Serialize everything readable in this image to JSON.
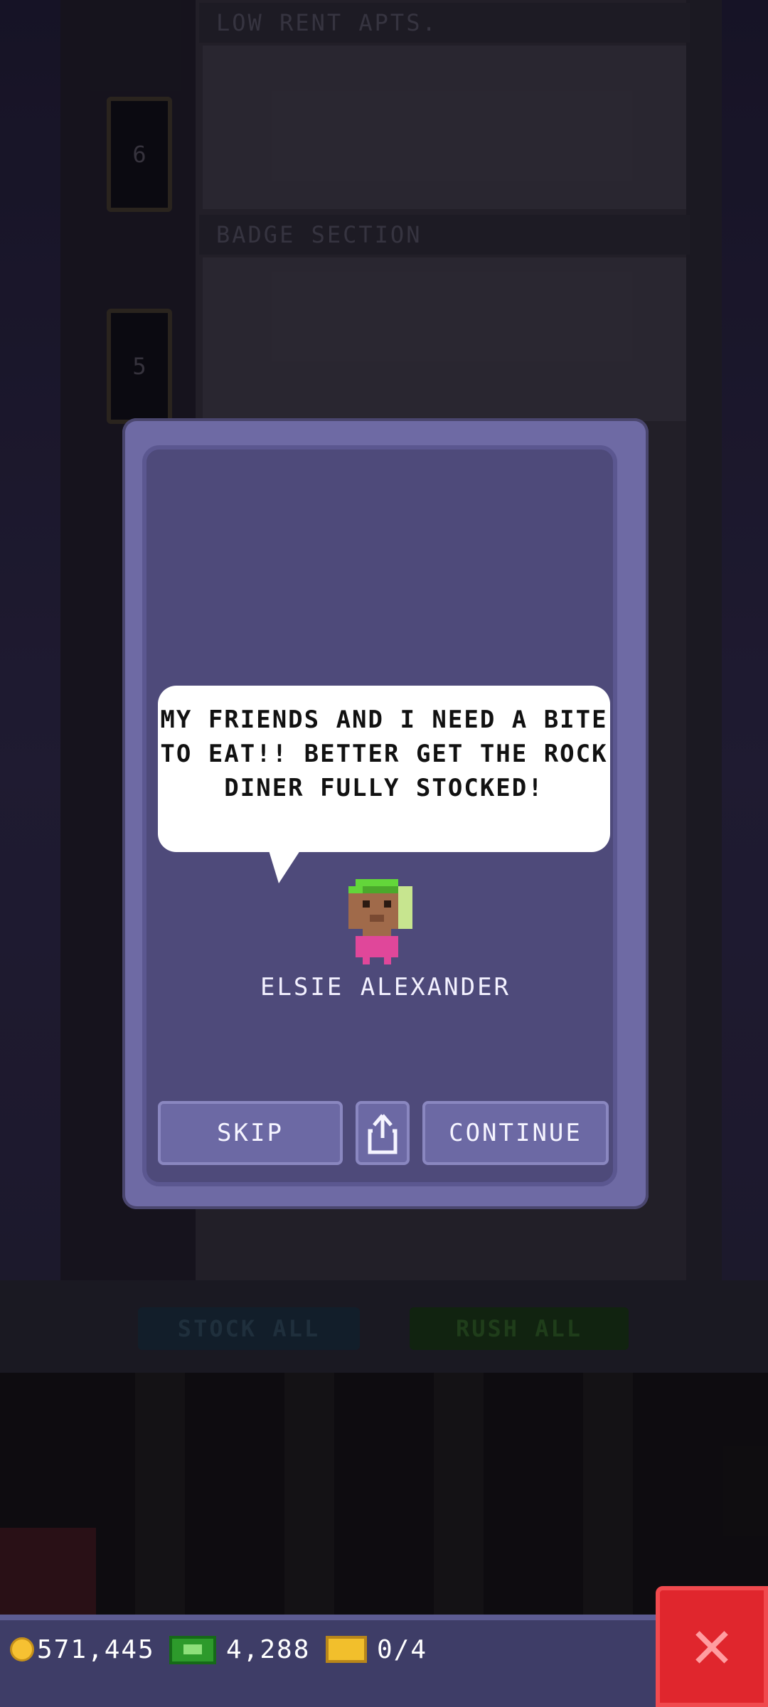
{
  "scene": {
    "floors": [
      {
        "label": "LOW RENT APTS.",
        "number": "6"
      },
      {
        "label": "BADGE SECTION",
        "number": "5"
      }
    ],
    "stock_all_label": "STOCK ALL",
    "rush_all_label": "RUSH ALL"
  },
  "dialog": {
    "message": "MY FRIENDS AND I NEED A BITE TO EAT!! BETTER GET THE ROCK DINER FULLY STOCKED!",
    "character_name": "ELSIE ALEXANDER",
    "skip_label": "SKIP",
    "continue_label": "CONTINUE",
    "share_icon": "share-icon"
  },
  "status_bar": {
    "coins": "571,445",
    "bux": "4,288",
    "tickets": "0/4",
    "close_icon": "close-icon"
  },
  "colors": {
    "dialog_frame": "#6e6aa4",
    "dialog_panel": "#4e4a7a",
    "status_bar": "#3e3d67",
    "close_button": "#e0262d"
  }
}
